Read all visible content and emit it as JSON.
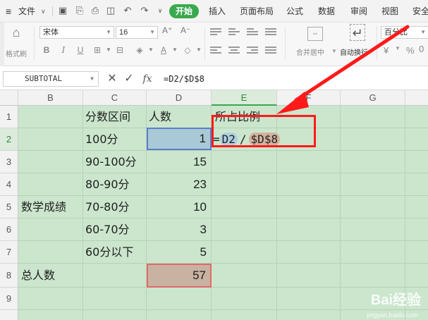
{
  "menubar": {
    "file_label": "文件",
    "active_tab": "开始",
    "tabs": [
      "插入",
      "页面布局",
      "公式",
      "数据",
      "审阅",
      "视图",
      "安全"
    ]
  },
  "ribbon": {
    "format_painter_label": "格式刷",
    "font_name": "宋体",
    "font_size": "16",
    "merge_center_label": "合并居中",
    "wrap_text_label": "自动换行",
    "number_format": "百分比"
  },
  "formula_bar": {
    "name_box": "SUBTOTAL",
    "cancel_glyph": "✕",
    "confirm_glyph": "✓",
    "fx_label": "fx",
    "formula": "=D2/$D$8"
  },
  "columns": [
    "B",
    "C",
    "D",
    "E",
    "F",
    "G"
  ],
  "active_column": "E",
  "rows": [
    "1",
    "2",
    "3",
    "4",
    "5",
    "6",
    "7",
    "8",
    "9"
  ],
  "active_row": "2",
  "cells": {
    "C1": "分数区间",
    "D1": "人数",
    "E1": "所占比例",
    "C2": "100分",
    "D2": "1",
    "C3": "90-100分",
    "D3": "15",
    "C4": "80-90分",
    "D4": "23",
    "B5": "数学成绩",
    "C5": "70-80分",
    "D5": "10",
    "C6": "60-70分",
    "D6": "3",
    "C7": "60分以下",
    "D7": "5",
    "B8": "总人数",
    "D8": "57"
  },
  "edit_cell": {
    "eq": "=",
    "ref1": "D2",
    "op": "/",
    "ref2": "$D$8"
  },
  "watermark": {
    "brand": "Bai经验",
    "url": "jingyan.baidu.com"
  },
  "colors": {
    "accent_green": "#3aa94e",
    "sheet_fill": "#cbe6cd",
    "annotation_red": "#ff1a1a"
  }
}
